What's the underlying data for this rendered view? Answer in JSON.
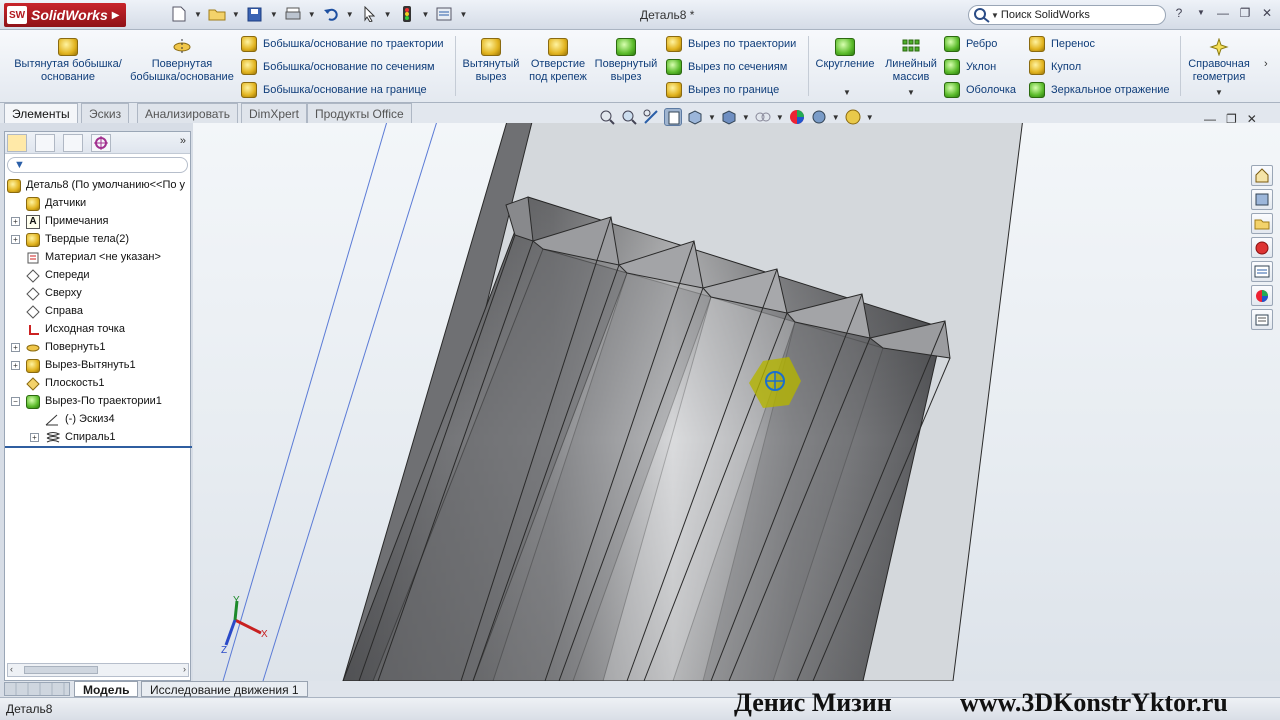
{
  "app": {
    "name": "SolidWorks",
    "logo_badge": "SW"
  },
  "window": {
    "document_title": "Деталь8 *",
    "search_placeholder": "Поиск SolidWorks"
  },
  "ribbon": {
    "extruded_boss": "Вытянутая бобышка/основание",
    "revolved_boss": "Повернутая бобышка/основание",
    "swept_boss": "Бобышка/основание по траектории",
    "lofted_boss": "Бобышка/основание по сечениям",
    "boundary_boss": "Бобышка/основание на границе",
    "extruded_cut": "Вытянутый вырез",
    "hole_wizard": "Отверстие под крепеж",
    "revolved_cut": "Повернутый вырез",
    "swept_cut": "Вырез по траектории",
    "lofted_cut": "Вырез по сечениям",
    "boundary_cut": "Вырез по границе",
    "fillet": "Скругление",
    "linear_pattern": "Линейный массив",
    "rib": "Ребро",
    "draft": "Уклон",
    "shell": "Оболочка",
    "wrap": "Перенос",
    "dome": "Купол",
    "mirror": "Зеркальное отражение",
    "reference_geometry": "Справочная геометрия"
  },
  "command_tabs": [
    "Элементы",
    "Эскиз",
    "Анализировать",
    "DimXpert",
    "Продукты Office"
  ],
  "tree": [
    {
      "label": "Деталь8  (По умолчанию<<По у",
      "icon": "part-icon"
    },
    {
      "label": "Датчики",
      "icon": "sensor-icon"
    },
    {
      "label": "Примечания",
      "icon": "annotation-icon"
    },
    {
      "label": "Твердые тела(2)",
      "icon": "solid-bodies-icon"
    },
    {
      "label": "Материал <не указан>",
      "icon": "material-icon"
    },
    {
      "label": "Спереди",
      "icon": "plane-icon"
    },
    {
      "label": "Сверху",
      "icon": "plane-icon"
    },
    {
      "label": "Справа",
      "icon": "plane-icon"
    },
    {
      "label": "Исходная точка",
      "icon": "origin-icon"
    },
    {
      "label": "Повернуть1",
      "icon": "revolve-icon"
    },
    {
      "label": "Вырез-Вытянуть1",
      "icon": "cut-extrude-icon"
    },
    {
      "label": "Плоскость1",
      "icon": "plane-icon"
    },
    {
      "label": "Вырез-По траектории1",
      "icon": "cut-sweep-icon"
    },
    {
      "label": "(-) Эскиз4",
      "icon": "sketch-icon"
    },
    {
      "label": "Спираль1",
      "icon": "helix-icon"
    }
  ],
  "bottom_tabs": [
    "Модель",
    "Исследование движения 1"
  ],
  "status": {
    "text": "Деталь8"
  },
  "watermark": {
    "author": "Денис Мизин",
    "site": "www.3DKonstrYktor.ru"
  },
  "triad": {
    "x": "X",
    "y": "Y",
    "z": "Z"
  },
  "colors": {
    "brand_red": "#c8242b",
    "link_blue": "#0f3d7a",
    "selection": "#b4b400"
  }
}
